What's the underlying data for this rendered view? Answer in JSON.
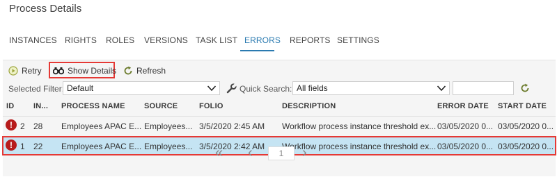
{
  "header": {
    "title": "Process Details"
  },
  "tabs": [
    {
      "label": "INSTANCES"
    },
    {
      "label": "RIGHTS"
    },
    {
      "label": "ROLES"
    },
    {
      "label": "VERSIONS"
    },
    {
      "label": "TASK LIST"
    },
    {
      "label": "ERRORS",
      "active": true
    },
    {
      "label": "REPORTS"
    },
    {
      "label": "SETTINGS"
    }
  ],
  "toolbar": {
    "retry_label": "Retry",
    "show_details_label": "Show Details",
    "refresh_label": "Refresh"
  },
  "filters": {
    "selected_filter_label": "Selected Filter:",
    "selected_filter_value": "Default",
    "quick_search_label": "Quick Search:",
    "quick_search_value": "All fields",
    "search_text": ""
  },
  "table": {
    "columns": [
      "ID",
      "IN...",
      "PROCESS NAME",
      "SOURCE",
      "FOLIO",
      "DESCRIPTION",
      "ERROR DATE",
      "START DATE"
    ],
    "rows": [
      {
        "id": "2",
        "instance": "28",
        "process_name": "Employees APAC E...",
        "source": "Employees...",
        "folio": "3/5/2020 2:45 AM",
        "description": "Workflow process instance threshold ex...",
        "error_date": "03/05/2020 0...",
        "start_date": "03/05/2020 0..."
      },
      {
        "id": "1",
        "instance": "22",
        "process_name": "Employees APAC E...",
        "source": "Employees...",
        "folio": "3/5/2020 2:42 AM",
        "description": "Workflow process instance threshold ex...",
        "error_date": "03/05/2020 0...",
        "start_date": "03/05/2020 0...",
        "selected": true
      }
    ]
  },
  "pager": {
    "current_page": "1"
  },
  "icons": {
    "retry": "play-circle-icon",
    "show_details": "binoculars-icon",
    "refresh": "refresh-icon",
    "quick_search": "wrench-icon",
    "error": "exclamation-circle-icon"
  },
  "colors": {
    "accent": "#2a7ab0",
    "highlight": "#e53935",
    "selected_row": "#c5e4f3",
    "error_icon": "#b71c1c"
  }
}
